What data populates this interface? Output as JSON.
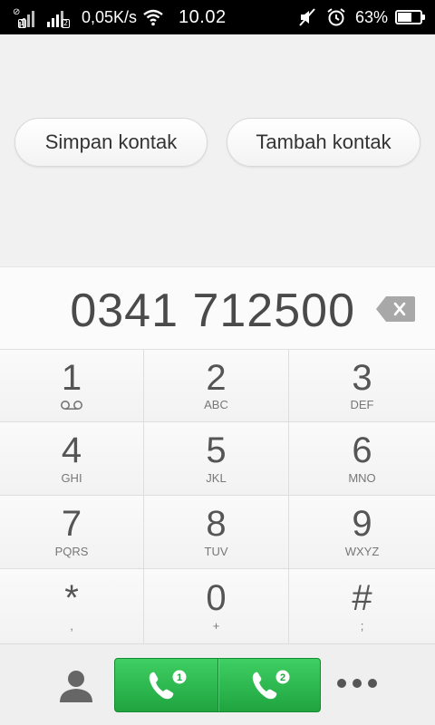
{
  "status_bar": {
    "sim1_label": "1",
    "sim2_label": "2",
    "data_speed": "0,05K/s",
    "time": "10.02",
    "battery_percent": "63%",
    "battery_level": 0.63,
    "icons": [
      "signal-icon",
      "signal-icon",
      "wifi-icon",
      "mute-icon",
      "alarm-icon",
      "battery-icon"
    ]
  },
  "actions": {
    "save_contact": "Simpan kontak",
    "add_contact": "Tambah kontak"
  },
  "dialer": {
    "number": "0341 712500",
    "keys": [
      {
        "digit": "1",
        "letters": ""
      },
      {
        "digit": "2",
        "letters": "ABC"
      },
      {
        "digit": "3",
        "letters": "DEF"
      },
      {
        "digit": "4",
        "letters": "GHI"
      },
      {
        "digit": "5",
        "letters": "JKL"
      },
      {
        "digit": "6",
        "letters": "MNO"
      },
      {
        "digit": "7",
        "letters": "PQRS"
      },
      {
        "digit": "8",
        "letters": "TUV"
      },
      {
        "digit": "9",
        "letters": "WXYZ"
      },
      {
        "digit": "*",
        "letters": ","
      },
      {
        "digit": "0",
        "letters": "+"
      },
      {
        "digit": "#",
        "letters": ";"
      }
    ]
  },
  "bottom_bar": {
    "call_sim1_badge": "1",
    "call_sim2_badge": "2"
  },
  "colors": {
    "call_green": "#2dbb50",
    "status_bar": "#000000"
  }
}
